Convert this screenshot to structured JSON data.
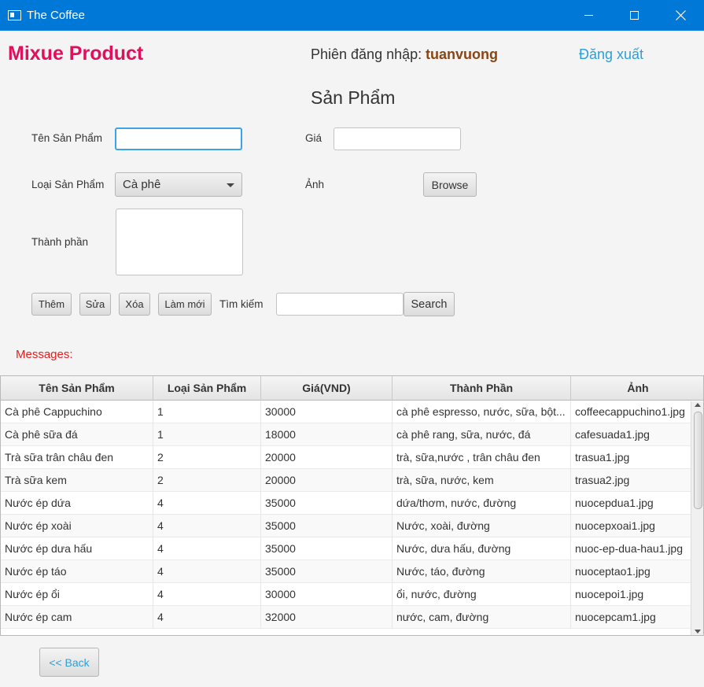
{
  "window": {
    "title": "The Coffee"
  },
  "header": {
    "brand": "Mixue Product",
    "session_label": "Phiên đăng nhập:",
    "session_user": "tuanvuong",
    "logout": "Đăng xuất"
  },
  "page_title": "Sản Phẩm",
  "form": {
    "name_label": "Tên Sản Phẩm",
    "name_value": "",
    "price_label": "Giá",
    "price_value": "",
    "category_label": "Loại Sản Phẩm",
    "category_selected": "Cà phê",
    "image_label": "Ảnh",
    "browse_button": "Browse",
    "ingredients_label": "Thành phần",
    "ingredients_value": ""
  },
  "actions": {
    "add": "Thêm",
    "edit": "Sửa",
    "delete": "Xóa",
    "refresh": "Làm mới",
    "search_label": "Tìm kiếm",
    "search_value": "",
    "search_button": "Search"
  },
  "messages_label": "Messages:",
  "table": {
    "columns": [
      "Tên Sản Phẩm",
      "Loại Sản Phẩm",
      "Giá(VND)",
      "Thành Phần",
      "Ảnh"
    ],
    "rows": [
      [
        "Cà phê Cappuchino",
        "1",
        "30000",
        "cà phê espresso, nước, sữa, bột...",
        "coffeecappuchino1.jpg"
      ],
      [
        "Cà phê sữa đá",
        "1",
        "18000",
        "cà phê rang, sữa, nước, đá",
        "cafesuada1.jpg"
      ],
      [
        "Trà sữa trân châu đen",
        "2",
        "20000",
        "trà, sữa,nước , trân châu đen",
        "trasua1.jpg"
      ],
      [
        "Trà sữa kem",
        "2",
        "20000",
        "trà, sữa, nước, kem",
        "trasua2.jpg"
      ],
      [
        "Nước ép dứa",
        "4",
        "35000",
        "dứa/thơm, nước, đường",
        "nuocepdua1.jpg"
      ],
      [
        "Nước ép xoài",
        "4",
        "35000",
        "Nước, xoài, đường",
        "nuocepxoai1.jpg"
      ],
      [
        "Nước ép dưa hấu",
        "4",
        "35000",
        "Nước, dưa hấu, đường",
        "nuoc-ep-dua-hau1.jpg"
      ],
      [
        "Nước ép táo",
        "4",
        "35000",
        "Nước, táo, đường",
        "nuoceptao1.jpg"
      ],
      [
        "Nước ép ổi",
        "4",
        "30000",
        "ổi, nước, đường",
        "nuocepoi1.jpg"
      ],
      [
        "Nước ép cam",
        "4",
        "32000",
        "nước, cam, đường",
        "nuocepcam1.jpg"
      ]
    ]
  },
  "back_button": "<< Back",
  "colors": {
    "titlebar": "#0078d7",
    "brand": "#e0105c",
    "user": "#8b4513",
    "link": "#2e9fd6",
    "messages": "#e02020"
  }
}
